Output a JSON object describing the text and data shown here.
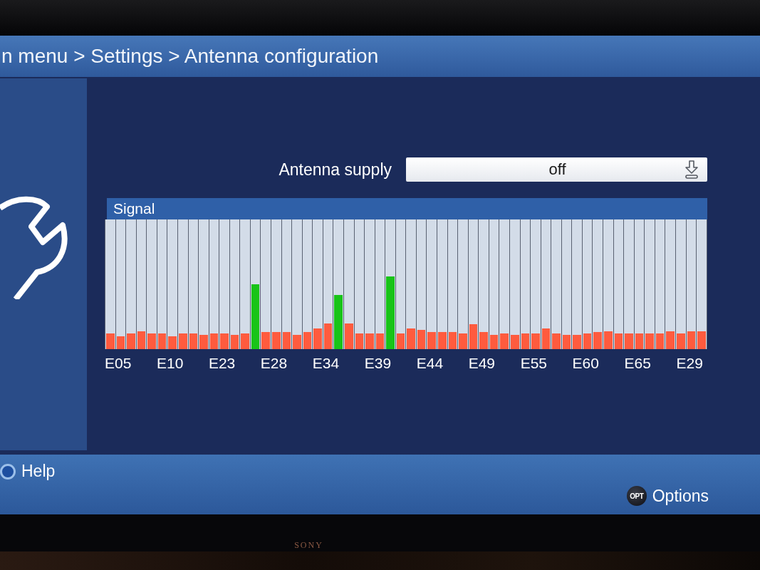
{
  "breadcrumb": "n menu > Settings > Antenna configuration",
  "antenna_supply": {
    "label": "Antenna supply",
    "value": "off"
  },
  "signal": {
    "title": "Signal",
    "bars": [
      {
        "level": 0.12,
        "color": "#ff5b3e"
      },
      {
        "level": 0.1,
        "color": "#ff5b3e"
      },
      {
        "level": 0.12,
        "color": "#ff5b3e"
      },
      {
        "level": 0.14,
        "color": "#ff5b3e"
      },
      {
        "level": 0.12,
        "color": "#ff5b3e"
      },
      {
        "level": 0.12,
        "color": "#ff5b3e"
      },
      {
        "level": 0.1,
        "color": "#ff5b3e"
      },
      {
        "level": 0.12,
        "color": "#ff5b3e"
      },
      {
        "level": 0.12,
        "color": "#ff5b3e"
      },
      {
        "level": 0.11,
        "color": "#ff5b3e"
      },
      {
        "level": 0.12,
        "color": "#ff5b3e"
      },
      {
        "level": 0.12,
        "color": "#ff5b3e"
      },
      {
        "level": 0.11,
        "color": "#ff5b3e"
      },
      {
        "level": 0.12,
        "color": "#ff5b3e"
      },
      {
        "level": 0.5,
        "color": "#18c418"
      },
      {
        "level": 0.13,
        "color": "#ff5b3e"
      },
      {
        "level": 0.13,
        "color": "#ff5b3e"
      },
      {
        "level": 0.13,
        "color": "#ff5b3e"
      },
      {
        "level": 0.11,
        "color": "#ff5b3e"
      },
      {
        "level": 0.13,
        "color": "#ff5b3e"
      },
      {
        "level": 0.16,
        "color": "#ff5b3e"
      },
      {
        "level": 0.2,
        "color": "#ff5b3e"
      },
      {
        "level": 0.42,
        "color": "#18c418"
      },
      {
        "level": 0.2,
        "color": "#ff5b3e"
      },
      {
        "level": 0.12,
        "color": "#ff5b3e"
      },
      {
        "level": 0.12,
        "color": "#ff5b3e"
      },
      {
        "level": 0.12,
        "color": "#ff5b3e"
      },
      {
        "level": 0.56,
        "color": "#18c418"
      },
      {
        "level": 0.12,
        "color": "#ff5b3e"
      },
      {
        "level": 0.16,
        "color": "#ff5b3e"
      },
      {
        "level": 0.15,
        "color": "#ff5b3e"
      },
      {
        "level": 0.13,
        "color": "#ff5b3e"
      },
      {
        "level": 0.13,
        "color": "#ff5b3e"
      },
      {
        "level": 0.13,
        "color": "#ff5b3e"
      },
      {
        "level": 0.12,
        "color": "#ff5b3e"
      },
      {
        "level": 0.19,
        "color": "#ff5b3e"
      },
      {
        "level": 0.13,
        "color": "#ff5b3e"
      },
      {
        "level": 0.11,
        "color": "#ff5b3e"
      },
      {
        "level": 0.12,
        "color": "#ff5b3e"
      },
      {
        "level": 0.11,
        "color": "#ff5b3e"
      },
      {
        "level": 0.12,
        "color": "#ff5b3e"
      },
      {
        "level": 0.12,
        "color": "#ff5b3e"
      },
      {
        "level": 0.16,
        "color": "#ff5b3e"
      },
      {
        "level": 0.12,
        "color": "#ff5b3e"
      },
      {
        "level": 0.11,
        "color": "#ff5b3e"
      },
      {
        "level": 0.11,
        "color": "#ff5b3e"
      },
      {
        "level": 0.12,
        "color": "#ff5b3e"
      },
      {
        "level": 0.13,
        "color": "#ff5b3e"
      },
      {
        "level": 0.14,
        "color": "#ff5b3e"
      },
      {
        "level": 0.12,
        "color": "#ff5b3e"
      },
      {
        "level": 0.12,
        "color": "#ff5b3e"
      },
      {
        "level": 0.12,
        "color": "#ff5b3e"
      },
      {
        "level": 0.12,
        "color": "#ff5b3e"
      },
      {
        "level": 0.12,
        "color": "#ff5b3e"
      },
      {
        "level": 0.14,
        "color": "#ff5b3e"
      },
      {
        "level": 0.12,
        "color": "#ff5b3e"
      },
      {
        "level": 0.14,
        "color": "#ff5b3e"
      },
      {
        "level": 0.14,
        "color": "#ff5b3e"
      }
    ],
    "labels": [
      "E05",
      "E10",
      "E23",
      "E28",
      "E34",
      "E39",
      "E44",
      "E49",
      "E55",
      "E60",
      "E65",
      "E29"
    ]
  },
  "footer": {
    "hints": [
      {
        "kind": "round_key",
        "label": "Help"
      },
      {
        "kind": "text_key",
        "key": "OPT",
        "label": "Options"
      }
    ]
  },
  "tv": {
    "brand": "SONY"
  }
}
